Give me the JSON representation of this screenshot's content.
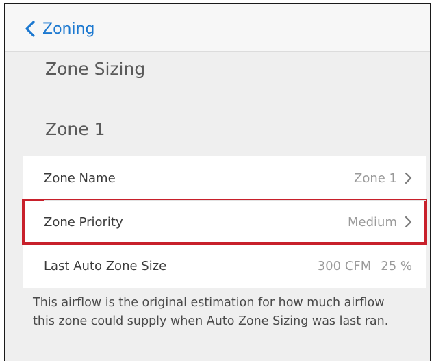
{
  "navbar": {
    "back_label": "Zoning"
  },
  "sections": {
    "sizing_title": "Zone Sizing",
    "zone_title": "Zone 1"
  },
  "rows": [
    {
      "label": "Zone Name",
      "value": "Zone 1"
    },
    {
      "label": "Zone Priority",
      "value": "Medium"
    },
    {
      "label": "Last Auto Zone Size",
      "value": "300 CFM",
      "value2": "25 %"
    }
  ],
  "footnote": "This airflow is the original estimation for how much airflow this zone could supply when Auto Zone Sizing was last ran.",
  "colors": {
    "accent": "#1b78d0",
    "highlight": "#c8202b",
    "background": "#efefef"
  },
  "icons": {
    "back": "chevron-left-icon",
    "row": "chevron-right-icon"
  }
}
